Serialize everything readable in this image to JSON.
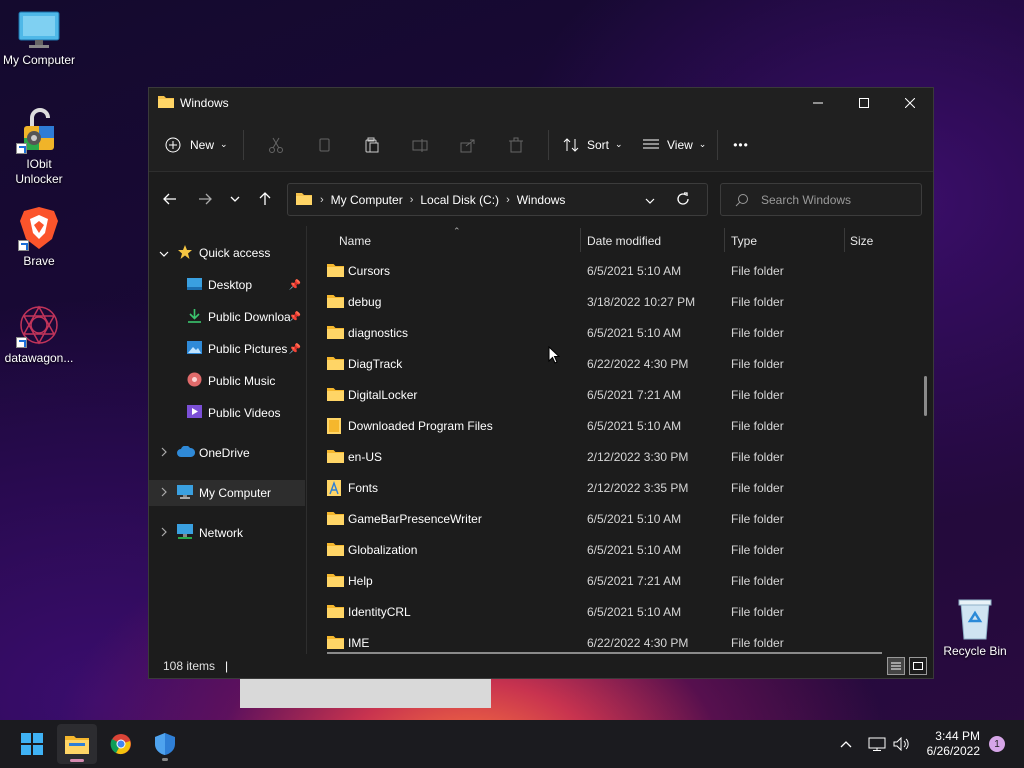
{
  "desktop": {
    "icons": [
      {
        "label": "My Computer"
      },
      {
        "label": "IObit Unlocker"
      },
      {
        "label": "Brave"
      },
      {
        "label": "datawagon..."
      },
      {
        "label": "Recycle Bin"
      }
    ]
  },
  "window": {
    "title": "Windows",
    "toolbar": {
      "new_label": "New",
      "sort_label": "Sort",
      "view_label": "View",
      "more_label": "•••"
    },
    "address": {
      "crumbs": [
        "My Computer",
        "Local Disk (C:)",
        "Windows"
      ]
    },
    "search": {
      "placeholder": "Search Windows"
    },
    "sidebar": {
      "quick_access": "Quick access",
      "items": [
        {
          "label": "Desktop"
        },
        {
          "label": "Public Downloa"
        },
        {
          "label": "Public Pictures"
        },
        {
          "label": "Public Music"
        },
        {
          "label": "Public Videos"
        }
      ],
      "onedrive": "OneDrive",
      "my_computer": "My Computer",
      "network": "Network"
    },
    "columns": {
      "name": "Name",
      "date": "Date modified",
      "type": "Type",
      "size": "Size"
    },
    "files": [
      {
        "name": "Cursors",
        "date": "6/5/2021 5:10 AM",
        "type": "File folder",
        "icon": "folder"
      },
      {
        "name": "debug",
        "date": "3/18/2022 10:27 PM",
        "type": "File folder",
        "icon": "folder"
      },
      {
        "name": "diagnostics",
        "date": "6/5/2021 5:10 AM",
        "type": "File folder",
        "icon": "folder"
      },
      {
        "name": "DiagTrack",
        "date": "6/22/2022 4:30 PM",
        "type": "File folder",
        "icon": "folder"
      },
      {
        "name": "DigitalLocker",
        "date": "6/5/2021 7:21 AM",
        "type": "File folder",
        "icon": "folder"
      },
      {
        "name": "Downloaded Program Files",
        "date": "6/5/2021 5:10 AM",
        "type": "File folder",
        "icon": "folder-special"
      },
      {
        "name": "en-US",
        "date": "2/12/2022 3:30 PM",
        "type": "File folder",
        "icon": "folder"
      },
      {
        "name": "Fonts",
        "date": "2/12/2022 3:35 PM",
        "type": "File folder",
        "icon": "folder-fonts"
      },
      {
        "name": "GameBarPresenceWriter",
        "date": "6/5/2021 5:10 AM",
        "type": "File folder",
        "icon": "folder"
      },
      {
        "name": "Globalization",
        "date": "6/5/2021 5:10 AM",
        "type": "File folder",
        "icon": "folder"
      },
      {
        "name": "Help",
        "date": "6/5/2021 7:21 AM",
        "type": "File folder",
        "icon": "folder"
      },
      {
        "name": "IdentityCRL",
        "date": "6/5/2021 5:10 AM",
        "type": "File folder",
        "icon": "folder"
      },
      {
        "name": "IME",
        "date": "6/22/2022 4:30 PM",
        "type": "File folder",
        "icon": "folder"
      }
    ],
    "status": {
      "count": "108 items"
    }
  },
  "taskbar": {
    "time": "3:44 PM",
    "date": "6/26/2022",
    "notifications": "1"
  }
}
